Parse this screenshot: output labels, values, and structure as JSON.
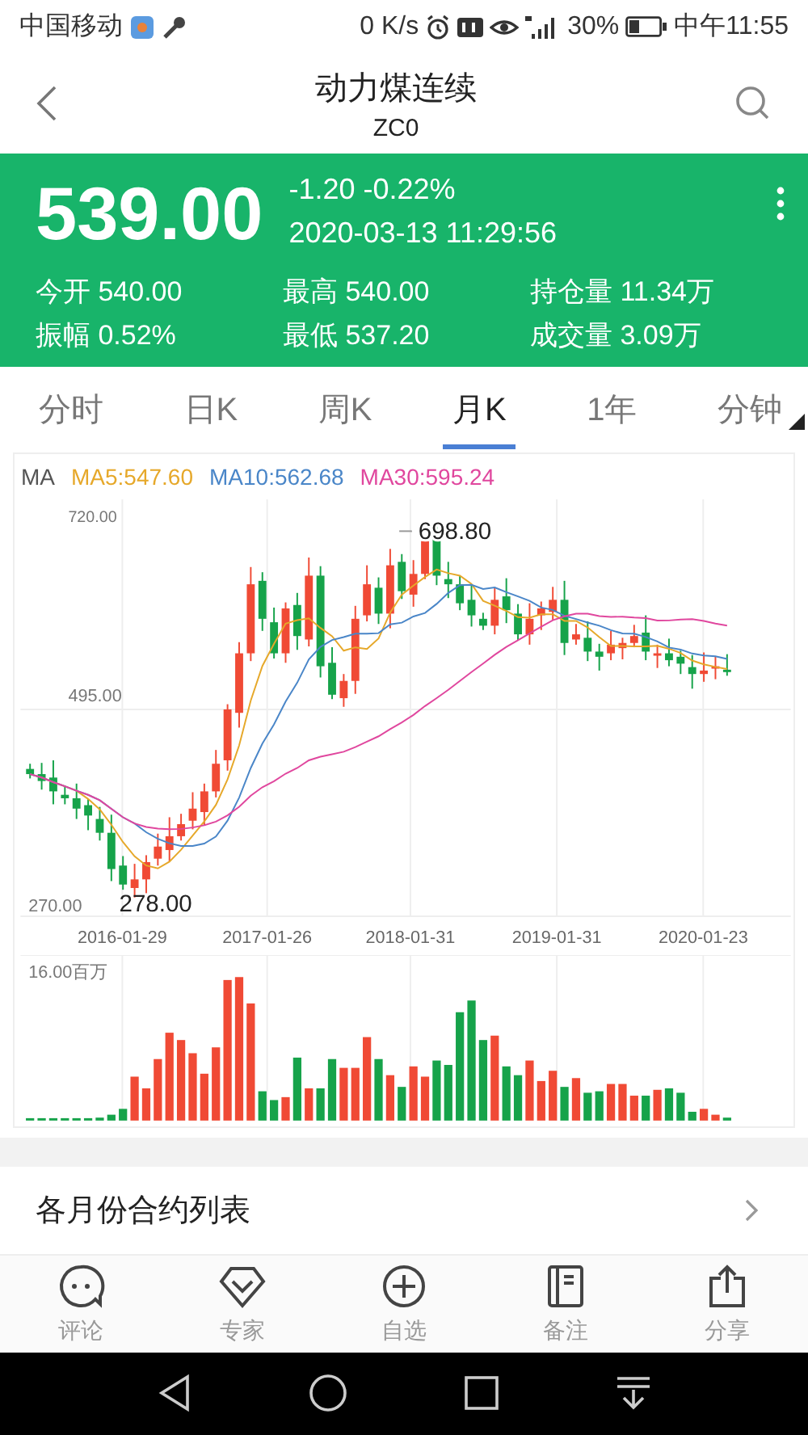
{
  "status_bar": {
    "carrier": "中国移动",
    "speed": "0 K/s",
    "battery": "30%",
    "time": "中午11:55"
  },
  "header": {
    "title": "动力煤连续",
    "code": "ZC0"
  },
  "quote": {
    "price": "539.00",
    "change": "-1.20 -0.22%",
    "time": "2020-03-13 11:29:56",
    "stats": [
      {
        "label": "今开",
        "value": "540.00"
      },
      {
        "label": "最高",
        "value": "540.00"
      },
      {
        "label": "持仓量",
        "value": "11.34万"
      },
      {
        "label": "振幅",
        "value": "0.52%"
      },
      {
        "label": "最低",
        "value": "537.20"
      },
      {
        "label": "成交量",
        "value": "3.09万"
      }
    ]
  },
  "tabs": [
    {
      "label": "分时",
      "selected": false
    },
    {
      "label": "日K",
      "selected": false
    },
    {
      "label": "周K",
      "selected": false
    },
    {
      "label": "月K",
      "selected": true
    },
    {
      "label": "1年",
      "selected": false
    },
    {
      "label": "分钟",
      "selected": false
    }
  ],
  "chart": {
    "indicator": "MA",
    "ma": [
      {
        "label": "MA5:547.60",
        "color": "#e6a82a"
      },
      {
        "label": "MA10:562.68",
        "color": "#4a86c8"
      },
      {
        "label": "MA30:595.24",
        "color": "#e0479e"
      }
    ],
    "y_labels": [
      "720.00",
      "495.00",
      "270.00"
    ],
    "high_label": "698.80",
    "low_label": "278.00",
    "dates": [
      "2016-01-29",
      "2017-01-26",
      "2018-01-31",
      "2019-01-31",
      "2020-01-23"
    ],
    "volume_label": "16.00百万"
  },
  "contracts_row": {
    "label": "各月份合约列表"
  },
  "bottom_nav": [
    {
      "label": "评论"
    },
    {
      "label": "专家"
    },
    {
      "label": "自选"
    },
    {
      "label": "备注"
    },
    {
      "label": "分享"
    }
  ]
}
